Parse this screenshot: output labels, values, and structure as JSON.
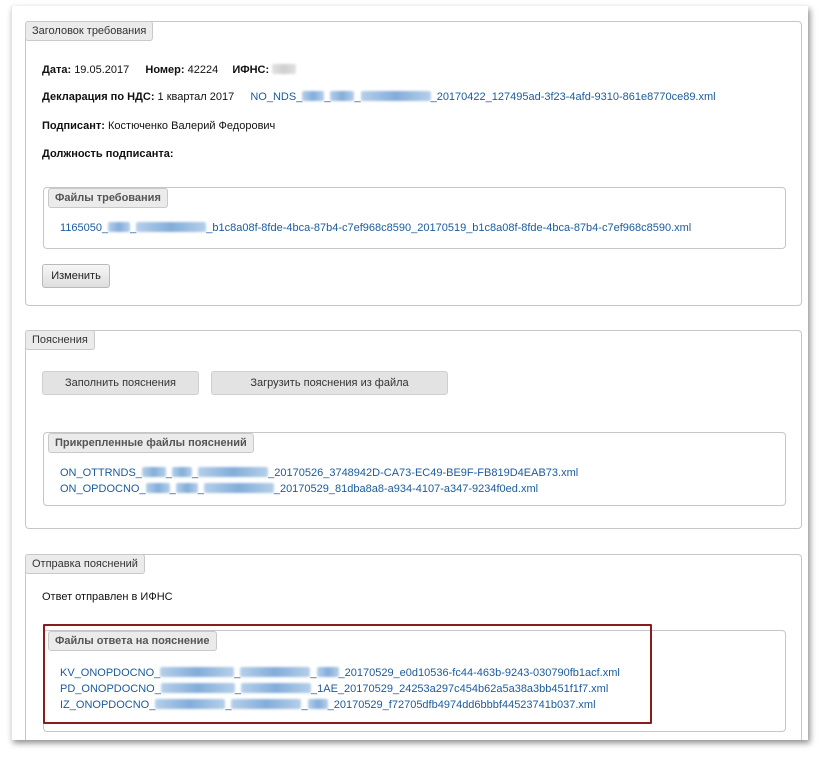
{
  "header_section": {
    "legend": "Заголовок требования",
    "date_label": "Дата:",
    "date_value": "19.05.2017",
    "number_label": "Номер:",
    "number_value": "42224",
    "ifns_label": "ИФНС:",
    "declaration_label": "Декларация по НДС:",
    "declaration_value": "1 квартал 2017",
    "declaration_file_prefix": "NO_NDS_",
    "declaration_file_suffix": "_20170422_127495ad-3f23-4afd-9310-861e8770ce89.xml",
    "signer_label": "Подписант:",
    "signer_value": "Костюченко Валерий Федорович",
    "position_label": "Должность подписанта:",
    "files_legend": "Файлы требования",
    "file_prefix": "1165050_",
    "file_suffix": "_b1c8a08f-8fde-4bca-87b4-c7ef968c8590_20170519_b1c8a08f-8fde-4bca-87b4-c7ef968c8590.xml",
    "change_button": "Изменить"
  },
  "explanations_section": {
    "legend": "Пояснения",
    "fill_button": "Заполнить пояснения",
    "upload_button": "Загрузить пояснения из файла",
    "files_legend": "Прикрепленные файлы пояснений",
    "files": [
      {
        "prefix": "ON_OTTRNDS_",
        "suffix": "_20170526_3748942D-CA73-EC49-BE9F-FB819D4EAB73.xml"
      },
      {
        "prefix": "ON_OPDOCNO_",
        "suffix": "_20170529_81dba8a8-a934-4107-a347-9234f0ed.xml"
      }
    ]
  },
  "sending_section": {
    "legend": "Отправка пояснений",
    "status_text": "Ответ отправлен в ИФНС",
    "files_legend": "Файлы ответа на пояснение",
    "files": [
      {
        "prefix": "KV_ONOPDOCNO_",
        "suffix": "_20170529_e0d10536-fc44-463b-9243-030790fb1acf.xml"
      },
      {
        "prefix": "PD_ONOPDOCNO_",
        "suffix": "1AE_20170529_24253a297c454b62a5a38a3bb451f1f7.xml"
      },
      {
        "prefix": "IZ_ONOPDOCNO_",
        "suffix": "_20170529_f72705dfb4974dd6bbbf44523741b037.xml"
      }
    ]
  },
  "colors": {
    "link": "#1a5b9e",
    "highlight": "#8b1c1c",
    "legend_bg": "#ebebeb"
  }
}
